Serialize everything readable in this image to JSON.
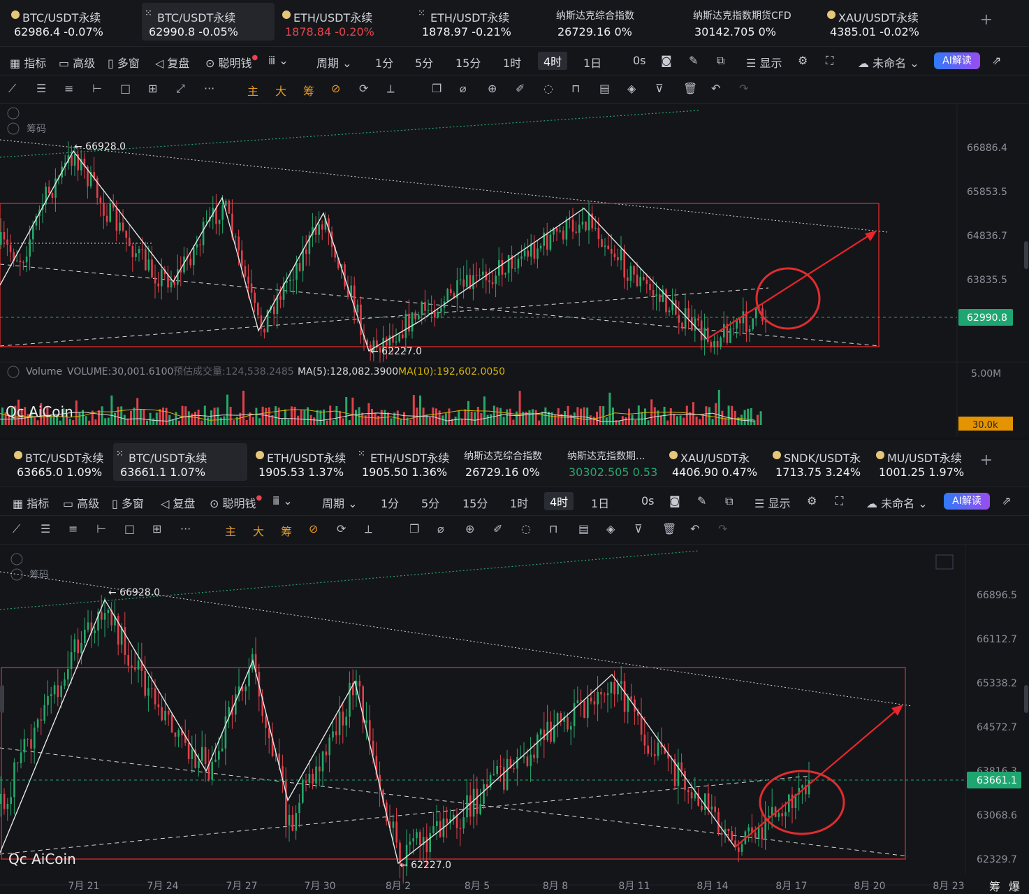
{
  "panels": [
    {
      "tickers": [
        {
          "name": "BTC/USDT永续",
          "value": "62986.4",
          "change": "-0.07%",
          "icon": "coin-icon",
          "color": "white"
        },
        {
          "name": "BTC/USDT永续",
          "value": "62990.8",
          "change": "-0.05%",
          "icon": "exchange-icon",
          "color": "white",
          "active": true
        },
        {
          "name": "ETH/USDT永续",
          "value": "1878.84",
          "change": "-0.20%",
          "icon": "coin-icon",
          "color": "red"
        },
        {
          "name": "ETH/USDT永续",
          "value": "1878.97",
          "change": "-0.21%",
          "icon": "exchange-icon",
          "color": "white"
        },
        {
          "name": "纳斯达克综合指数",
          "value": "26729.16",
          "change": "0%",
          "icon": "",
          "color": "white"
        },
        {
          "name": "纳斯达克指数期货CFD",
          "value": "30142.705",
          "change": "0%",
          "icon": "",
          "color": "white"
        },
        {
          "name": "XAU/USDT永续",
          "value": "4385.01",
          "change": "-0.02%",
          "icon": "coin-icon",
          "color": "white"
        }
      ],
      "price_labels": [
        "66886.4",
        "65853.5",
        "64836.7",
        "63835.5",
        "62990.8"
      ],
      "current_price": "62990.8",
      "high_label": "66928.0",
      "low_label": "62227.0",
      "volume_info": {
        "label": "Volume",
        "volume": "VOLUME:30,001.6100",
        "estimate": "预估成交量:124,538.2485",
        "ma5": "MA(5):128,082.3900",
        "ma10": "MA(10):192,602.0050",
        "axis_top": "5.00M",
        "axis_current": "30.0k"
      }
    },
    {
      "tickers": [
        {
          "name": "BTC/USDT永续",
          "value": "63665.0",
          "change": "1.09%",
          "icon": "coin-icon",
          "color": "white"
        },
        {
          "name": "BTC/USDT永续",
          "value": "63661.1",
          "change": "1.07%",
          "icon": "exchange-icon",
          "color": "white",
          "active": true
        },
        {
          "name": "ETH/USDT永续",
          "value": "1905.53",
          "change": "1.37%",
          "icon": "coin-icon",
          "color": "white"
        },
        {
          "name": "ETH/USDT永续",
          "value": "1905.50",
          "change": "1.36%",
          "icon": "exchange-icon",
          "color": "white"
        },
        {
          "name": "纳斯达克综合指数",
          "value": "26729.16",
          "change": "0%",
          "icon": "",
          "color": "white"
        },
        {
          "name": "纳斯达克指数期...",
          "value": "30302.505",
          "change": "0.53",
          "icon": "",
          "color": "green"
        },
        {
          "name": "XAU/USDT永",
          "value": "4406.90",
          "change": "0.47%",
          "icon": "coin-icon",
          "color": "white"
        },
        {
          "name": "SNDK/USDT永",
          "value": "1713.75",
          "change": "3.24%",
          "icon": "coin-icon",
          "color": "white"
        },
        {
          "name": "MU/USDT永续",
          "value": "1001.25",
          "change": "1.97%",
          "icon": "coin-icon",
          "color": "white"
        }
      ],
      "price_labels": [
        "66896.5",
        "66112.7",
        "65338.2",
        "64572.7",
        "63816.3",
        "63068.6",
        "62329.7"
      ],
      "current_price": "63661.1",
      "high_label": "66928.0",
      "low_label": "62227.0",
      "dates": [
        "7月 21",
        "7月 24",
        "7月 27",
        "7月 30",
        "8月 2",
        "8月 5",
        "8月 8",
        "8月 11",
        "8月 14",
        "8月 17",
        "8月 20",
        "8月 23"
      ],
      "corner_labels": [
        "筹",
        "爆"
      ]
    }
  ],
  "menu": {
    "indicator": "指标",
    "advanced": "高级",
    "multi": "多窗",
    "replay": "复盘",
    "smart": "聪明钱",
    "period": "周期",
    "m1": "1分",
    "m5": "5分",
    "m15": "15分",
    "h1": "1时",
    "h4": "4时",
    "d1": "1日",
    "countdown": "0s",
    "display": "显示",
    "unnamed": "未命名",
    "ai": "AI解读"
  },
  "tools": {
    "main": "主",
    "big": "大",
    "chip": "筹"
  },
  "chip_label": "筹码",
  "watermark": "AiCoin",
  "colors": {
    "up": "#26a86a",
    "down": "#e0404a",
    "box": "#e02b2b",
    "current": "#1fa670",
    "volume_ma10": "#d6b600"
  }
}
